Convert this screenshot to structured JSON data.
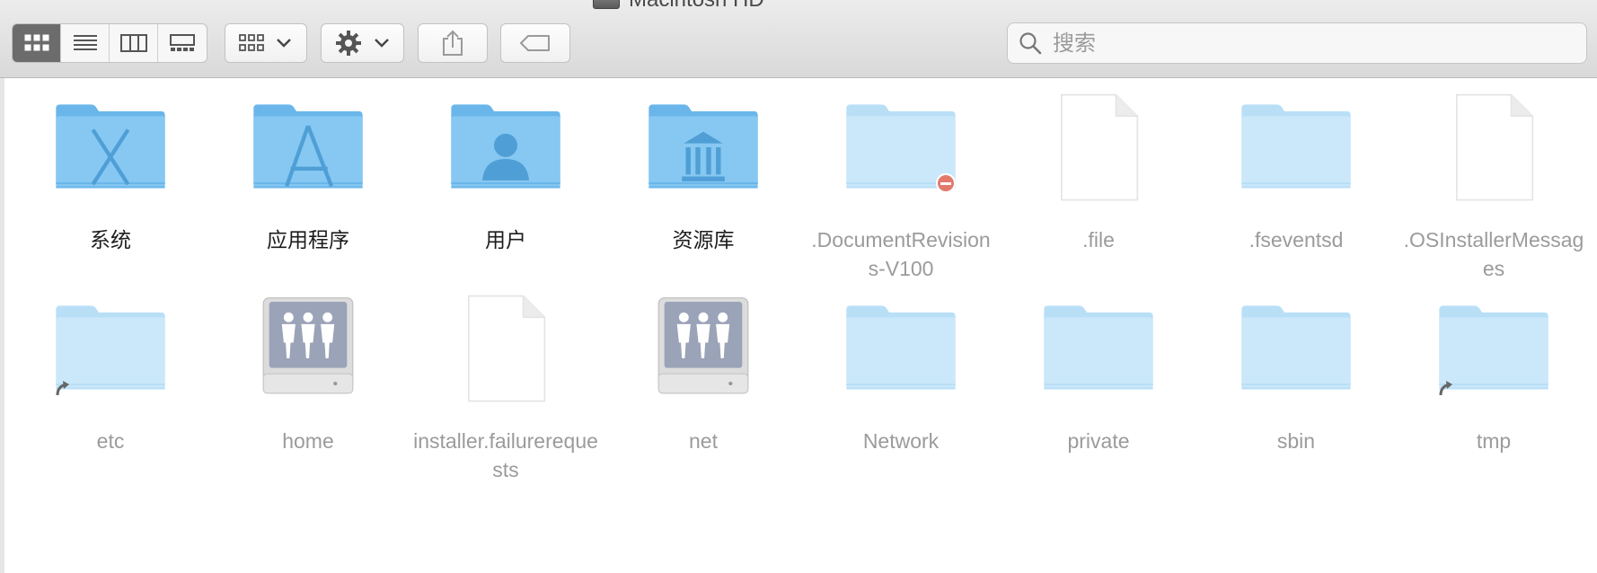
{
  "window": {
    "title": "Macintosh HD"
  },
  "toolbar": {
    "view_modes": [
      "icon-view",
      "list-view",
      "column-view",
      "gallery-view"
    ],
    "active_view": "icon-view",
    "search_placeholder": "搜索"
  },
  "items": [
    {
      "name": "系统",
      "icon": "system-folder",
      "dim": false
    },
    {
      "name": "应用程序",
      "icon": "applications-folder",
      "dim": false
    },
    {
      "name": "用户",
      "icon": "users-folder",
      "dim": false
    },
    {
      "name": "资源库",
      "icon": "library-folder",
      "dim": false
    },
    {
      "name": ".DocumentRevisions-V100",
      "icon": "restricted-folder",
      "dim": true
    },
    {
      "name": ".file",
      "icon": "blank-file",
      "dim": true
    },
    {
      "name": ".fseventsd",
      "icon": "hidden-folder",
      "dim": true
    },
    {
      "name": ".OSInstallerMessages",
      "icon": "blank-file",
      "dim": true
    },
    {
      "name": "etc",
      "icon": "alias-folder",
      "dim": true
    },
    {
      "name": "home",
      "icon": "network-volume",
      "dim": true
    },
    {
      "name": "installer.failurerequests",
      "icon": "blank-file",
      "dim": true
    },
    {
      "name": "net",
      "icon": "network-volume",
      "dim": true
    },
    {
      "name": "Network",
      "icon": "hidden-folder",
      "dim": true
    },
    {
      "name": "private",
      "icon": "hidden-folder",
      "dim": true
    },
    {
      "name": "sbin",
      "icon": "hidden-folder",
      "dim": true
    },
    {
      "name": "tmp",
      "icon": "alias-folder",
      "dim": true
    }
  ],
  "colors": {
    "folder_front": "#86c8f2",
    "folder_back": "#6ab6ea",
    "folder_dim_front": "#cbe8fa",
    "folder_dim_back": "#b9dff7",
    "folder_glyph": "#4f9fd6",
    "restricted_badge": "#e27a6c"
  }
}
